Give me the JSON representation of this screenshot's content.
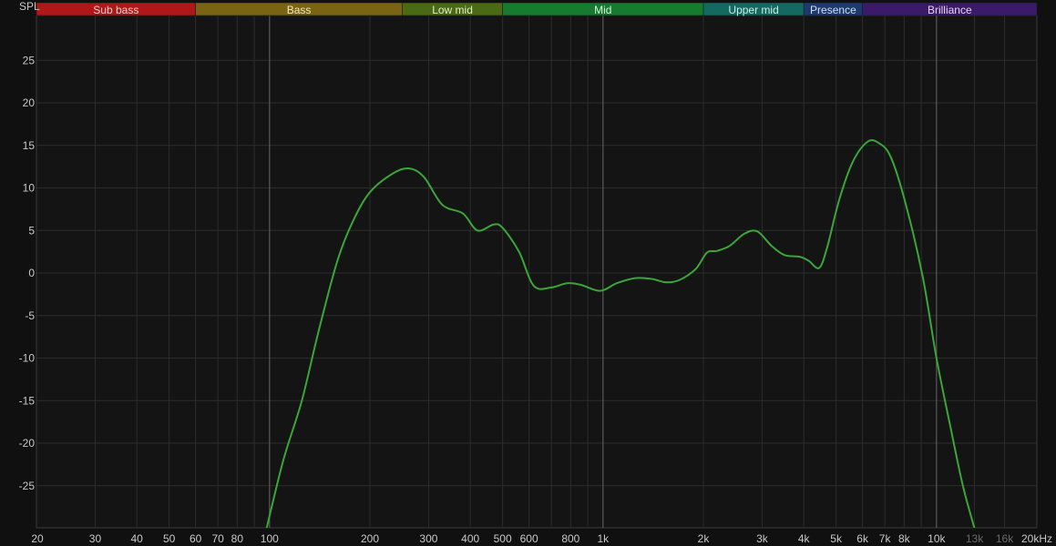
{
  "chart_data": {
    "type": "line",
    "ylabel": "SPL",
    "xscale": "log",
    "xlim": [
      20,
      20000
    ],
    "ylim": [
      -30,
      30
    ],
    "grid": true,
    "colors": {
      "background": "#101010",
      "plot_background": "#141414",
      "grid": "#2c2c2c",
      "curve": "#3aa63a",
      "tick_text": "#c8c8c8",
      "tick_text_dim": "#6a6a6a"
    },
    "y_ticks": [
      {
        "value": 25,
        "label": "25"
      },
      {
        "value": 20,
        "label": "20"
      },
      {
        "value": 15,
        "label": "15"
      },
      {
        "value": 10,
        "label": "10"
      },
      {
        "value": 5,
        "label": "5"
      },
      {
        "value": 0,
        "label": "0"
      },
      {
        "value": -5,
        "label": "-5"
      },
      {
        "value": -10,
        "label": "-10"
      },
      {
        "value": -15,
        "label": "-15"
      },
      {
        "value": -20,
        "label": "-20"
      },
      {
        "value": -25,
        "label": "-25"
      }
    ],
    "x_ticks": [
      {
        "value": 20,
        "label": "20"
      },
      {
        "value": 30,
        "label": "30"
      },
      {
        "value": 40,
        "label": "40"
      },
      {
        "value": 50,
        "label": "50"
      },
      {
        "value": 60,
        "label": "60"
      },
      {
        "value": 70,
        "label": "70"
      },
      {
        "value": 80,
        "label": "80"
      },
      {
        "value": 100,
        "label": "100"
      },
      {
        "value": 200,
        "label": "200"
      },
      {
        "value": 300,
        "label": "300"
      },
      {
        "value": 400,
        "label": "400"
      },
      {
        "value": 500,
        "label": "500"
      },
      {
        "value": 600,
        "label": "600"
      },
      {
        "value": 800,
        "label": "800"
      },
      {
        "value": 1000,
        "label": "1k"
      },
      {
        "value": 2000,
        "label": "2k"
      },
      {
        "value": 3000,
        "label": "3k"
      },
      {
        "value": 4000,
        "label": "4k"
      },
      {
        "value": 5000,
        "label": "5k"
      },
      {
        "value": 6000,
        "label": "6k"
      },
      {
        "value": 7000,
        "label": "7k"
      },
      {
        "value": 8000,
        "label": "8k"
      },
      {
        "value": 10000,
        "label": "10k"
      },
      {
        "value": 13000,
        "label": "13k",
        "dim": true
      },
      {
        "value": 16000,
        "label": "16k",
        "dim": true
      },
      {
        "value": 20000,
        "label": "20kHz"
      }
    ],
    "minor_gridlines": [
      70,
      80,
      90,
      600,
      700,
      800,
      900,
      6000,
      7000,
      8000,
      9000
    ],
    "strong_gridlines": [
      100,
      1000,
      10000
    ],
    "bands": [
      {
        "name": "Sub bass",
        "from": 20,
        "to": 60,
        "color": "#b01818",
        "text_color": "#f0d0d0"
      },
      {
        "name": "Bass",
        "from": 60,
        "to": 250,
        "color": "#7a6414",
        "text_color": "#f0e6c0"
      },
      {
        "name": "Low mid",
        "from": 250,
        "to": 500,
        "color": "#4a6a14",
        "text_color": "#e0ecc8"
      },
      {
        "name": "Mid",
        "from": 500,
        "to": 2000,
        "color": "#177a2e",
        "text_color": "#d0f0d8"
      },
      {
        "name": "Upper mid",
        "from": 2000,
        "to": 4000,
        "color": "#146a60",
        "text_color": "#c8ece6"
      },
      {
        "name": "Presence",
        "from": 4000,
        "to": 6000,
        "color": "#1c3a70",
        "text_color": "#d0dcf2"
      },
      {
        "name": "Brilliance",
        "from": 6000,
        "to": 20000,
        "color": "#3c1a6a",
        "text_color": "#e2d4f2"
      }
    ],
    "series": [
      {
        "points": [
          [
            98,
            -30
          ],
          [
            110,
            -22
          ],
          [
            125,
            -15
          ],
          [
            140,
            -7
          ],
          [
            160,
            1.5
          ],
          [
            180,
            6.5
          ],
          [
            200,
            9.5
          ],
          [
            230,
            11.5
          ],
          [
            260,
            12.3
          ],
          [
            290,
            11.3
          ],
          [
            330,
            8
          ],
          [
            380,
            7
          ],
          [
            420,
            5
          ],
          [
            470,
            5.7
          ],
          [
            500,
            5.3
          ],
          [
            560,
            2.5
          ],
          [
            620,
            -1.5
          ],
          [
            700,
            -1.7
          ],
          [
            780,
            -1.2
          ],
          [
            860,
            -1.4
          ],
          [
            980,
            -2.1
          ],
          [
            1100,
            -1.2
          ],
          [
            1250,
            -0.6
          ],
          [
            1400,
            -0.7
          ],
          [
            1550,
            -1.1
          ],
          [
            1700,
            -0.8
          ],
          [
            1900,
            0.5
          ],
          [
            2050,
            2.4
          ],
          [
            2200,
            2.6
          ],
          [
            2400,
            3.2
          ],
          [
            2650,
            4.6
          ],
          [
            2900,
            4.9
          ],
          [
            3200,
            3.2
          ],
          [
            3500,
            2.1
          ],
          [
            3900,
            1.9
          ],
          [
            4150,
            1.4
          ],
          [
            4450,
            0.6
          ],
          [
            4700,
            3
          ],
          [
            5100,
            8.5
          ],
          [
            5600,
            13
          ],
          [
            6200,
            15.4
          ],
          [
            6700,
            15.3
          ],
          [
            7300,
            13.6
          ],
          [
            8100,
            8
          ],
          [
            9100,
            -0.5
          ],
          [
            10000,
            -10
          ],
          [
            11000,
            -18
          ],
          [
            12000,
            -25
          ],
          [
            13000,
            -30
          ]
        ]
      }
    ]
  }
}
